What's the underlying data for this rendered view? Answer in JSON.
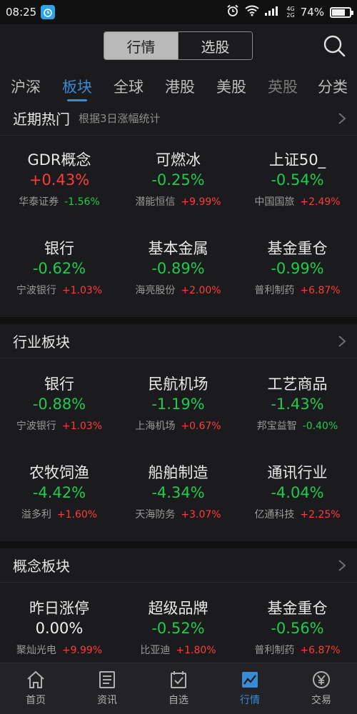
{
  "status_bar": {
    "time": "08:25",
    "net_top": "4G",
    "net_bottom": "2G",
    "battery": "74%",
    "battery_level": 0.74
  },
  "header": {
    "seg_active": "行情",
    "seg_inactive": "选股"
  },
  "tabs": [
    "沪深",
    "板块",
    "全球",
    "港股",
    "美股",
    "英股",
    "分类"
  ],
  "sections": [
    {
      "title": "近期热门",
      "subtitle": "根据3日涨幅统计",
      "items": [
        {
          "name": "GDR概念",
          "pct": "+0.43%",
          "dir": "up",
          "stock": "华泰证券",
          "chg": "-1.56%",
          "chg_dir": "down"
        },
        {
          "name": "可燃冰",
          "pct": "-0.25%",
          "dir": "down",
          "stock": "潜能恒信",
          "chg": "+9.99%",
          "chg_dir": "up"
        },
        {
          "name": "上证50_",
          "pct": "-0.54%",
          "dir": "down",
          "stock": "中国国旅",
          "chg": "+2.49%",
          "chg_dir": "up"
        },
        {
          "name": "银行",
          "pct": "-0.62%",
          "dir": "down",
          "stock": "宁波银行",
          "chg": "+1.03%",
          "chg_dir": "up"
        },
        {
          "name": "基本金属",
          "pct": "-0.89%",
          "dir": "down",
          "stock": "海亮股份",
          "chg": "+2.00%",
          "chg_dir": "up"
        },
        {
          "name": "基金重仓",
          "pct": "-0.99%",
          "dir": "down",
          "stock": "普利制药",
          "chg": "+6.87%",
          "chg_dir": "up"
        }
      ]
    },
    {
      "title": "行业板块",
      "subtitle": "",
      "items": [
        {
          "name": "银行",
          "pct": "-0.88%",
          "dir": "down",
          "stock": "宁波银行",
          "chg": "+1.03%",
          "chg_dir": "up"
        },
        {
          "name": "民航机场",
          "pct": "-1.19%",
          "dir": "down",
          "stock": "上海机场",
          "chg": "+0.67%",
          "chg_dir": "up"
        },
        {
          "name": "工艺商品",
          "pct": "-1.43%",
          "dir": "down",
          "stock": "邦宝益智",
          "chg": "-0.40%",
          "chg_dir": "down"
        },
        {
          "name": "农牧饲渔",
          "pct": "-4.42%",
          "dir": "down",
          "stock": "溢多利",
          "chg": "+1.60%",
          "chg_dir": "up"
        },
        {
          "name": "船舶制造",
          "pct": "-4.34%",
          "dir": "down",
          "stock": "天海防务",
          "chg": "+3.07%",
          "chg_dir": "up"
        },
        {
          "name": "通讯行业",
          "pct": "-4.04%",
          "dir": "down",
          "stock": "亿通科技",
          "chg": "+2.25%",
          "chg_dir": "up"
        }
      ]
    },
    {
      "title": "概念板块",
      "subtitle": "",
      "items": [
        {
          "name": "昨日涨停",
          "pct": "0.00%",
          "dir": "flat",
          "stock": "聚灿光电",
          "chg": "+9.99%",
          "chg_dir": "up"
        },
        {
          "name": "超级品牌",
          "pct": "-0.52%",
          "dir": "down",
          "stock": "比亚迪",
          "chg": "+1.80%",
          "chg_dir": "up"
        },
        {
          "name": "基金重仓",
          "pct": "-0.56%",
          "dir": "down",
          "stock": "普利制药",
          "chg": "+6.87%",
          "chg_dir": "up"
        }
      ]
    }
  ],
  "bottom_nav": [
    {
      "label": "首页",
      "icon": "home-icon"
    },
    {
      "label": "资讯",
      "icon": "news-icon"
    },
    {
      "label": "自选",
      "icon": "watchlist-icon"
    },
    {
      "label": "行情",
      "icon": "market-chart-icon"
    },
    {
      "label": "交易",
      "icon": "trade-yen-icon"
    }
  ],
  "colors": {
    "up": "#ff3b3b",
    "down": "#1ecb4f",
    "accent": "#3a8bd6",
    "background": "#1b1b1d"
  }
}
